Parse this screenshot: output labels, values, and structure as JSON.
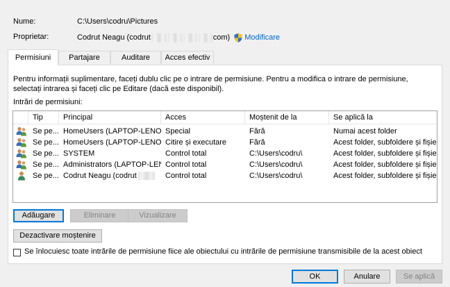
{
  "header": {
    "name_label": "Nume:",
    "name_value": "C:\\Users\\codru\\Pictures",
    "owner_label": "Proprietar:",
    "owner_prefix": "Codrut Neagu (codrut",
    "owner_suffix": "com)",
    "change_link": "Modificare"
  },
  "tabs": [
    {
      "label": "Permisiuni",
      "active": true
    },
    {
      "label": "Partajare"
    },
    {
      "label": "Auditare"
    },
    {
      "label": "Acces efectiv"
    }
  ],
  "panel": {
    "info_text": "Pentru informații suplimentare, faceți dublu clic pe o intrare de permisiune. Pentru a modifica o intrare de permisiune, selectați intrarea și faceți clic pe Editare (dacă este disponibil).",
    "entries_label": "Intrări de permisiuni:",
    "columns": [
      "Tip",
      "Principal",
      "Acces",
      "Moștenit de la",
      "Se aplică la"
    ],
    "rows": [
      {
        "icon": "group-user-icon",
        "tip": "Se pe...",
        "principal": "HomeUsers (LAPTOP-LENOV...",
        "acces": "Special",
        "inherited": "Fără",
        "applies": "Numai acest folder"
      },
      {
        "icon": "group-user-icon",
        "tip": "Se pe...",
        "principal": "HomeUsers (LAPTOP-LENOV...",
        "acces": "Citire și executare",
        "inherited": "Fără",
        "applies": "Acest folder, subfoldere și fișiere"
      },
      {
        "icon": "group-user-icon",
        "tip": "Se pe...",
        "principal": "SYSTEM",
        "acces": "Control total",
        "inherited": "C:\\Users\\codru\\",
        "applies": "Acest folder, subfoldere și fișiere"
      },
      {
        "icon": "group-user-icon",
        "tip": "Se pe...",
        "principal": "Administrators (LAPTOP-LEN...",
        "acces": "Control total",
        "inherited": "C:\\Users\\codru\\",
        "applies": "Acest folder, subfoldere și fișiere"
      },
      {
        "icon": "single-user-icon",
        "tip": "Se pe...",
        "principal": "Codrut Neagu (codrut",
        "acces": "Control total",
        "inherited": "C:\\Users\\codru\\",
        "applies": "Acest folder, subfoldere și fișiere"
      }
    ],
    "buttons": {
      "add": "Adăugare",
      "remove": "Eliminare",
      "view": "Vizualizare",
      "disable_inheritance": "Dezactivare moștenire"
    },
    "replace_checkbox_label": "Se înlocuiesc toate intrările de permisiune fiice ale obiectului cu intrările de permisiune transmisibile de la acest obiect",
    "replace_checked": false
  },
  "footer": {
    "ok": "OK",
    "cancel": "Anulare",
    "apply": "Se aplică"
  }
}
